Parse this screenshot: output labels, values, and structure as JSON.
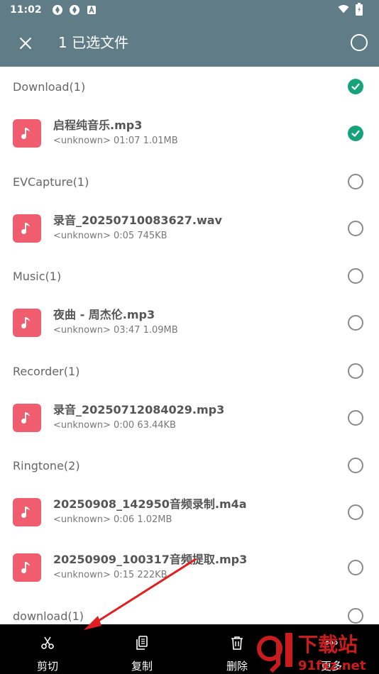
{
  "status_bar": {
    "time": "11:02"
  },
  "app_bar": {
    "title": "1 已选文件"
  },
  "groups": [
    {
      "label": "Download(1)",
      "checked": true
    },
    {
      "label": "EVCapture(1)",
      "checked": false
    },
    {
      "label": "Music(1)",
      "checked": false
    },
    {
      "label": "Recorder(1)",
      "checked": false
    },
    {
      "label": "Ringtone(2)",
      "checked": false
    },
    {
      "label": "download(1)",
      "checked": false
    }
  ],
  "files": [
    {
      "name": "启程纯音乐.mp3",
      "meta": "<unknown> 01:07 1.01MB",
      "checked": true
    },
    {
      "name": "录音_20250710083627.wav",
      "meta": "<unknown> 0:05 745KB",
      "checked": false
    },
    {
      "name": "夜曲 - 周杰伦.mp3",
      "meta": "<unknown> 03:47 1.09MB",
      "checked": false
    },
    {
      "name": "录音_20250712084029.mp3",
      "meta": "<unknown> 0:00 63.44KB",
      "checked": false
    },
    {
      "name": "20250908_142950音频录制.m4a",
      "meta": "<unknown> 0:06 1.02MB",
      "checked": false
    },
    {
      "name": "20250909_100317音频提取.mp3",
      "meta": "<unknown> 0:15 222KB",
      "checked": false
    }
  ],
  "bottom_bar": {
    "cut_label": "剪切",
    "copy_label": "复制",
    "delete_label": "删除",
    "more_label": "更多"
  },
  "watermark": {
    "text": "下载站",
    "site": "91fxz.net"
  },
  "colors": {
    "app_bar": "#5f7c87",
    "file_icon": "#ef5d6f",
    "checked": "#16a37b",
    "annotation_arrow": "#e02020"
  },
  "icons": {
    "close": "close-icon",
    "select_all": "circle-outline-icon",
    "file": "music-note-icon",
    "cut": "scissors-icon",
    "copy": "copy-icon",
    "delete": "trash-icon",
    "more": "more-dots-icon"
  }
}
